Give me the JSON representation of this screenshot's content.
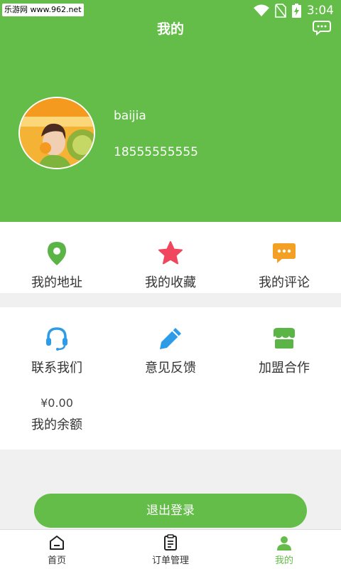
{
  "statusbar": {
    "watermark": "乐游网 www.962.net",
    "time": "3:04"
  },
  "header": {
    "title": "我的"
  },
  "profile": {
    "username": "baijia",
    "phone": "18555555555"
  },
  "grid1": [
    {
      "label": "我的地址",
      "icon": "location-pin-icon",
      "color": "#5bb446"
    },
    {
      "label": "我的收藏",
      "icon": "star-icon",
      "color": "#f0475e"
    },
    {
      "label": "我的评论",
      "icon": "comment-icon",
      "color": "#f3a024"
    }
  ],
  "grid2": [
    {
      "label": "联系我们",
      "icon": "headset-icon",
      "color": "#2e9be6"
    },
    {
      "label": "意见反馈",
      "icon": "pencil-icon",
      "color": "#2e9be6"
    },
    {
      "label": "加盟合作",
      "icon": "shop-icon",
      "color": "#5bb446"
    }
  ],
  "balance": {
    "value": "¥0.00",
    "label": "我的余额"
  },
  "logout_label": "退出登录",
  "tabs": [
    {
      "label": "首页",
      "icon": "home-icon"
    },
    {
      "label": "订单管理",
      "icon": "order-list-icon"
    },
    {
      "label": "我的",
      "icon": "user-icon"
    }
  ],
  "colors": {
    "brand": "#63bd48"
  }
}
